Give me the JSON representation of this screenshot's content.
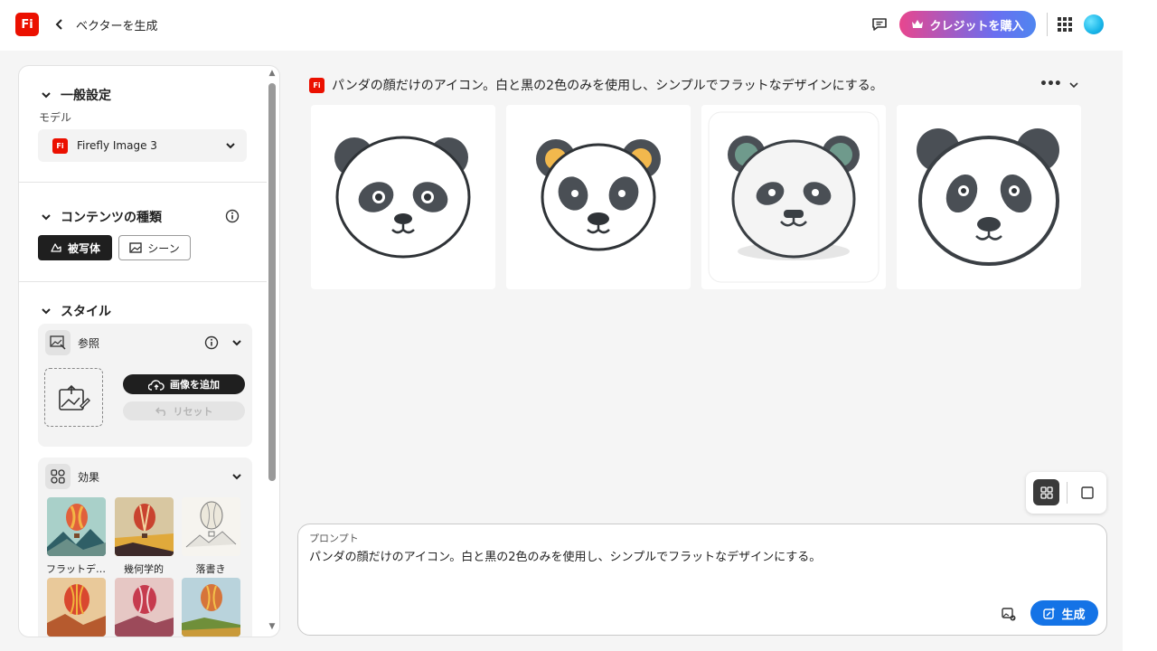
{
  "header": {
    "app_logo_text": "Fi",
    "page_title": "ベクターを生成",
    "buy_credits_label": "クレジットを購入"
  },
  "sidebar": {
    "general": {
      "title": "一般設定",
      "model_label": "モデル",
      "model_value": "Firefly Image 3"
    },
    "content_type": {
      "title": "コンテンツの種類",
      "options": [
        "被写体",
        "シーン"
      ],
      "selected": "被写体"
    },
    "style": {
      "title": "スタイル",
      "reference": {
        "title": "参照",
        "add_image_label": "画像を追加",
        "reset_label": "リセット"
      },
      "effects": {
        "title": "効果",
        "items": [
          {
            "label": "フラットデ…"
          },
          {
            "label": "幾何学的"
          },
          {
            "label": "落書き"
          },
          {
            "label": ""
          },
          {
            "label": ""
          },
          {
            "label": ""
          }
        ]
      }
    }
  },
  "main": {
    "prompt_heading": "パンダの顔だけのアイコン。白と黒の2色のみを使用し、シンプルでフラットなデザインにする。",
    "results": [
      {
        "alt": "panda-1"
      },
      {
        "alt": "panda-2"
      },
      {
        "alt": "panda-3"
      },
      {
        "alt": "panda-4"
      }
    ],
    "prompt_box": {
      "label": "プロンプト",
      "value": "パンダの顔だけのアイコン。白と黒の2色のみを使用し、シンプルでフラットなデザインにする。"
    },
    "generate_label": "生成"
  },
  "colors": {
    "brand_red": "#eb1000",
    "generate_blue": "#1473e6"
  }
}
